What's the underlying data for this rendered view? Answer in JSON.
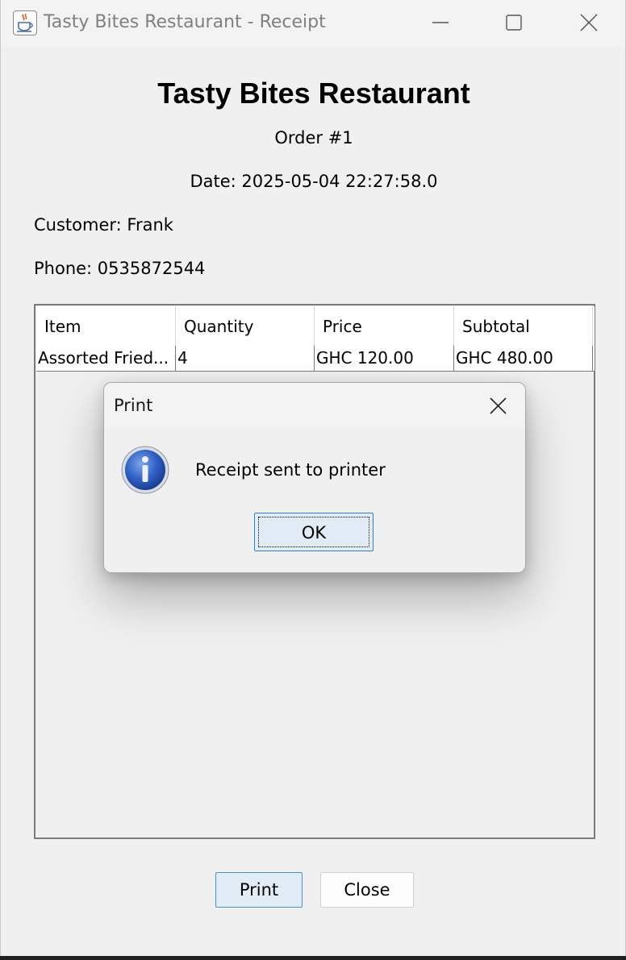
{
  "window": {
    "title": "Tasty Bites Restaurant - Receipt",
    "icon": "java-cup-icon"
  },
  "receipt": {
    "restaurant_name": "Tasty Bites Restaurant",
    "order": "Order #1",
    "date": "Date: 2025-05-04 22:27:58.0",
    "customer": "Customer: Frank",
    "phone": "Phone: 0535872544"
  },
  "table": {
    "columns": [
      "Item",
      "Quantity",
      "Price",
      "Subtotal"
    ],
    "rows": [
      [
        "Assorted Fried...",
        "4",
        "GHC 120.00",
        "GHC 480.00"
      ]
    ]
  },
  "buttons": {
    "print": "Print",
    "close": "Close"
  },
  "dialog": {
    "title": "Print",
    "message": "Receipt sent to printer",
    "ok": "OK",
    "icon": "info-icon"
  },
  "colors": {
    "window_bg": "#f0f0f0",
    "focus_blue": "#2f7fd1",
    "button_blue_bg": "#e1ecf7"
  }
}
